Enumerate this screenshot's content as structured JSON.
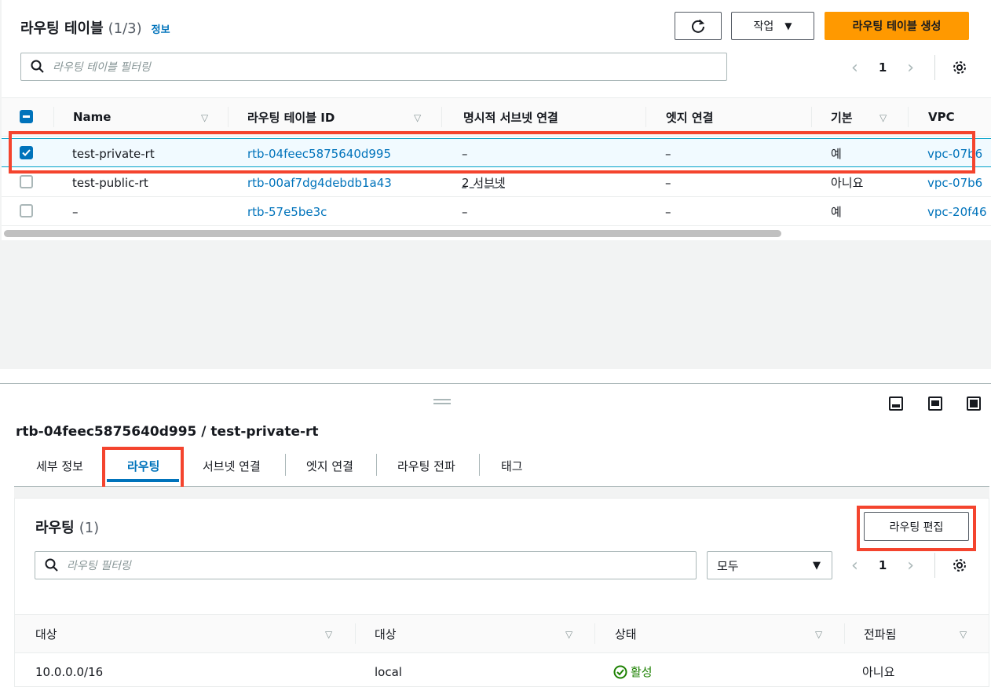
{
  "header": {
    "title": "라우팅 테이블",
    "count": "(1/3)",
    "info_link": "정보",
    "actions_label": "작업",
    "create_label": "라우팅 테이블 생성",
    "search_placeholder": "라우팅 테이블 필터링",
    "page_number": "1"
  },
  "table": {
    "columns": [
      "Name",
      "라우팅 테이블 ID",
      "명시적 서브넷 연결",
      "엣지 연결",
      "기본",
      "VPC"
    ],
    "rows": [
      {
        "name": "test-private-rt",
        "id": "rtb-04feec5875640d995",
        "subnet": "–",
        "edge": "–",
        "main": "예",
        "vpc": "vpc-07b6",
        "selected": true
      },
      {
        "name": "test-public-rt",
        "id": "rtb-00af7dg4debdb1a43",
        "subnet": "2 서브넷",
        "edge": "–",
        "main": "아니요",
        "vpc": "vpc-07b6",
        "selected": false
      },
      {
        "name": "–",
        "id": "rtb-57e5be3c",
        "subnet": "–",
        "edge": "–",
        "main": "예",
        "vpc": "vpc-20f46",
        "selected": false
      }
    ]
  },
  "detail": {
    "title": "rtb-04feec5875640d995 / test-private-rt",
    "tabs": [
      "세부 정보",
      "라우팅",
      "서브넷 연결",
      "엣지 연결",
      "라우팅 전파",
      "태그"
    ],
    "active_tab": "라우팅"
  },
  "routes": {
    "title": "라우팅",
    "count": "(1)",
    "edit_label": "라우팅 편집",
    "search_placeholder": "라우팅 필터링",
    "filter_value": "모두",
    "page_number": "1",
    "columns": [
      "대상",
      "대상",
      "상태",
      "전파됨"
    ],
    "rows": [
      {
        "destination": "10.0.0.0/16",
        "target": "local",
        "status": "활성",
        "propagated": "아니요"
      }
    ]
  },
  "colors": {
    "accent": "#0073bb",
    "primary_button": "#ff9900",
    "highlight_box": "#f4442e",
    "status_active": "#1d8102"
  }
}
